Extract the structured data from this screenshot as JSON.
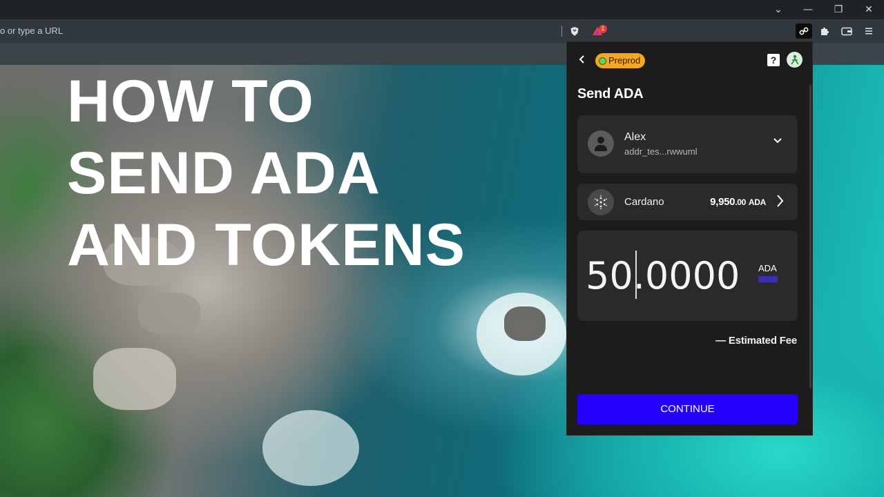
{
  "browser": {
    "omnibox_placeholder": "o or type a URL",
    "window_controls": {
      "tabs_dropdown": "⌄",
      "minimize": "—",
      "restore": "❐",
      "close": "✕"
    },
    "badge_count": "1",
    "icons": [
      "brave-shield-icon",
      "brave-rewards-icon",
      "link-extension-icon",
      "puzzle-extensions-icon",
      "wallet-icon",
      "menu-icon"
    ]
  },
  "headline": {
    "line1": "HOW TO",
    "line2": "SEND ADA",
    "line3": "AND TOKENS"
  },
  "wallet": {
    "network_label": "Preprod",
    "help_label": "?",
    "title": "Send ADA",
    "recipient": {
      "name": "Alex",
      "address": "addr_tes...rwwuml"
    },
    "token": {
      "name": "Cardano",
      "balance_main": "9,950",
      "balance_decimals": ".00",
      "balance_unit": "ADA"
    },
    "amount": {
      "value": "50.0000",
      "unit": "ADA"
    },
    "fee_label": "— Estimated Fee",
    "continue_label": "CONTINUE",
    "colors": {
      "network_badge": "#f5a623",
      "continue_button": "#2400ff",
      "panel_bg": "#1c1c1c",
      "card_bg": "#2a2a2a"
    }
  }
}
